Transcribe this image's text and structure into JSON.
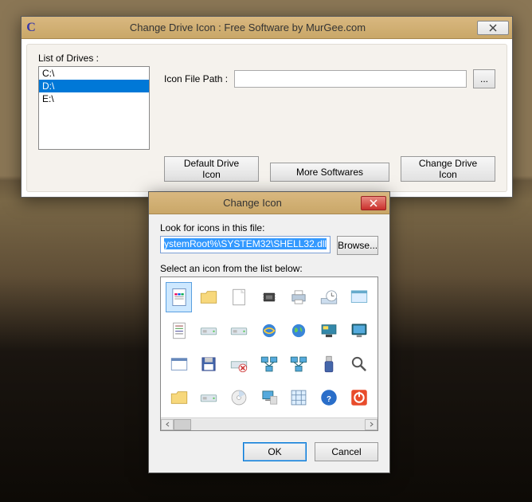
{
  "window1": {
    "title": "Change Drive Icon : Free Software by MurGee.com",
    "drives_label": "List of Drives :",
    "drives": [
      "C:\\",
      "D:\\",
      "E:\\"
    ],
    "selected_drive_index": 1,
    "icon_path_label": "Icon File Path :",
    "icon_path_value": "",
    "browse_label": "...",
    "default_icon_btn": "Default Drive Icon",
    "more_softwares_btn": "More Softwares",
    "change_icon_btn": "Change Drive Icon"
  },
  "window2": {
    "title": "Change Icon",
    "look_label": "Look for icons in this file:",
    "file_value": "ystemRoot%\\SYSTEM32\\SHELL32.dll",
    "browse_label": "Browse...",
    "select_label": "Select an icon from the list below:",
    "selected_icon_index": 0,
    "icons": [
      "document-icon",
      "folder-icon",
      "page-icon",
      "chip-icon",
      "printer-icon",
      "clock-disk-icon",
      "window-icon",
      "text-page-icon",
      "drive-icon",
      "drive2-icon",
      "globe-ie-icon",
      "globe-icon",
      "desktop-icon",
      "monitor-icon",
      "window-blank-icon",
      "floppy-icon",
      "drive-x-icon",
      "network-icon",
      "network2-icon",
      "usb-icon",
      "search-icon",
      "folder2-icon",
      "drive3-icon",
      "cd-icon",
      "computer-icon",
      "grid-icon",
      "help-icon",
      "power-icon"
    ],
    "ok_label": "OK",
    "cancel_label": "Cancel"
  }
}
